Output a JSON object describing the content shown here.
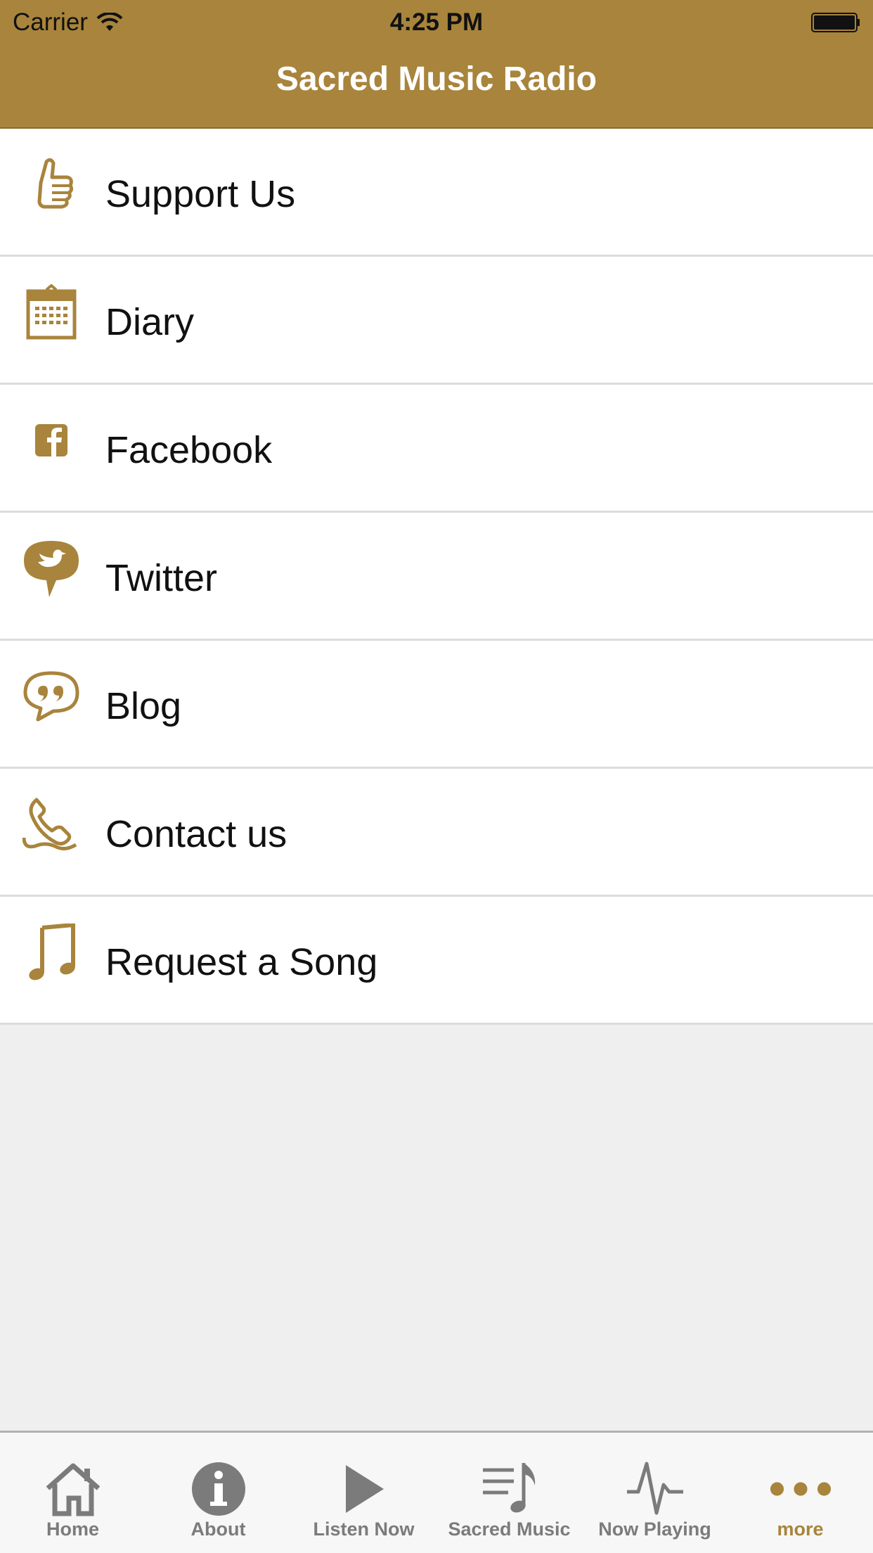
{
  "status_bar": {
    "carrier": "Carrier",
    "time": "4:25 PM"
  },
  "nav": {
    "title": "Sacred Music Radio"
  },
  "menu_items": [
    {
      "label": "Support Us",
      "icon": "thumbs-up-icon"
    },
    {
      "label": "Diary",
      "icon": "calendar-icon"
    },
    {
      "label": "Facebook",
      "icon": "facebook-icon"
    },
    {
      "label": "Twitter",
      "icon": "twitter-bird-icon"
    },
    {
      "label": "Blog",
      "icon": "quote-bubble-icon"
    },
    {
      "label": "Contact us",
      "icon": "phone-icon"
    },
    {
      "label": "Request a Song",
      "icon": "music-note-icon"
    }
  ],
  "tabs": [
    {
      "label": "Home",
      "icon": "home-icon",
      "active": false
    },
    {
      "label": "About",
      "icon": "info-icon",
      "active": false
    },
    {
      "label": "Listen Now",
      "icon": "play-icon",
      "active": false
    },
    {
      "label": "Sacred Music",
      "icon": "playlist-icon",
      "active": false
    },
    {
      "label": "Now Playing",
      "icon": "pulse-icon",
      "active": false
    },
    {
      "label": "more",
      "icon": "more-dots-icon",
      "active": true
    }
  ],
  "colors": {
    "accent": "#a8843c",
    "tab_inactive": "#7b7b7b",
    "background": "#efefef"
  }
}
